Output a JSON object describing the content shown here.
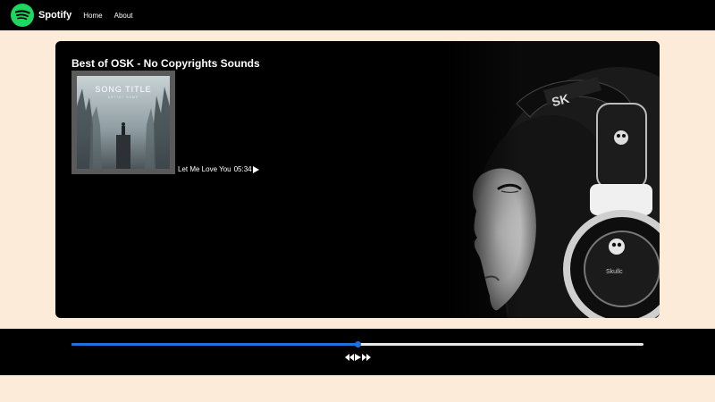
{
  "navbar": {
    "brand": "Spotify",
    "links": [
      "Home",
      "About"
    ]
  },
  "playlist": {
    "title": "Best of OSK - No Copyrights Sounds",
    "cover": {
      "title": "SONG TITLE",
      "artist": "ARTIST NAME"
    },
    "songs": [
      {
        "name": "Let Me Love You",
        "duration": "05:34"
      }
    ]
  },
  "player": {
    "progress_percent": 50
  },
  "icons": {
    "logo": "spotify-logo-icon",
    "play": "play-icon",
    "previous": "previous-icon",
    "next": "next-icon"
  },
  "colors": {
    "brand_green": "#1ed760",
    "progress_blue": "#1e6fe0",
    "page_background": "#fcebd9",
    "bar_background": "#000000"
  }
}
